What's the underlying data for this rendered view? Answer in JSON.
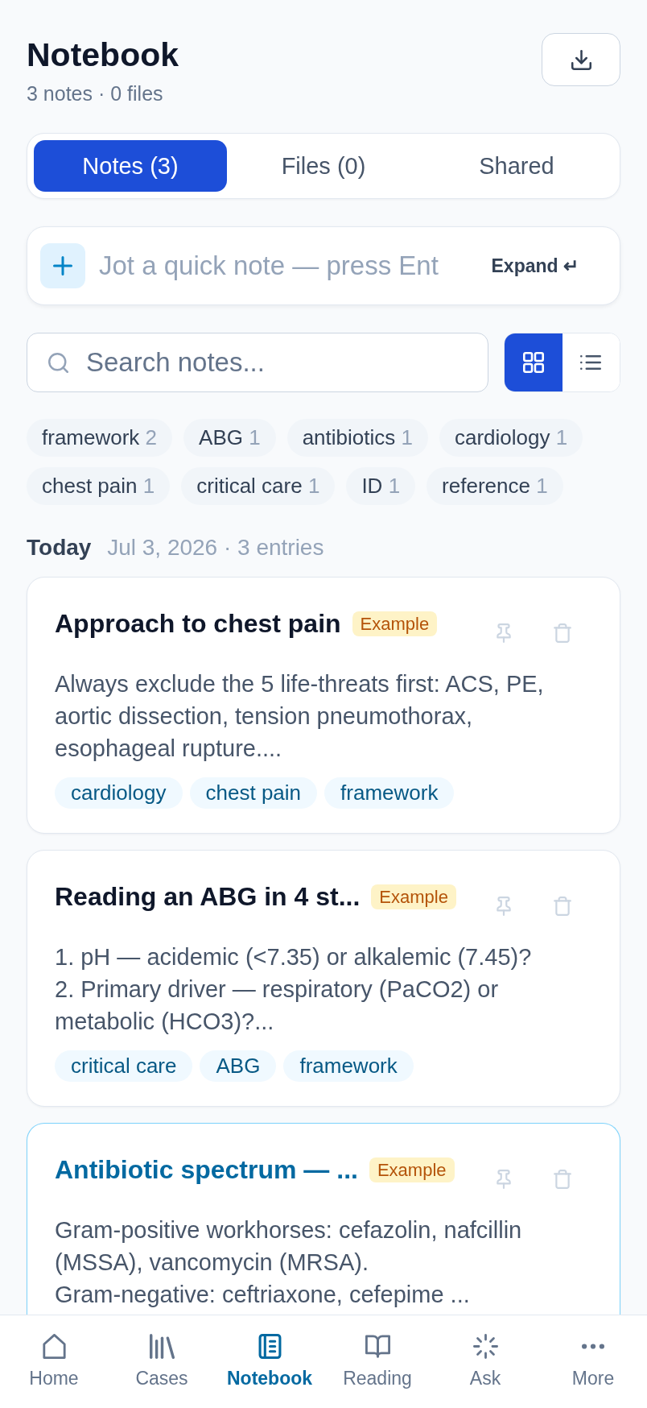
{
  "header": {
    "title": "Notebook",
    "subtitle": "3 notes · 0 files"
  },
  "tabs": [
    {
      "label": "Notes (3)",
      "selected": true
    },
    {
      "label": "Files (0)",
      "selected": false
    },
    {
      "label": "Shared",
      "selected": false
    }
  ],
  "quick_note": {
    "placeholder": "Jot a quick note — press Ent",
    "expand_label": "Expand ↵"
  },
  "search": {
    "placeholder": "Search notes..."
  },
  "view_modes": [
    {
      "kind": "grid",
      "selected": true
    },
    {
      "kind": "list",
      "selected": false
    }
  ],
  "tag_filters": [
    {
      "label": "framework",
      "count": "2",
      "selected": false
    },
    {
      "label": "ABG",
      "count": "1",
      "selected": false
    },
    {
      "label": "antibiotics",
      "count": "1",
      "selected": false
    },
    {
      "label": "cardiology",
      "count": "1",
      "selected": false
    },
    {
      "label": "chest pain",
      "count": "1",
      "selected": false
    },
    {
      "label": "critical care",
      "count": "1",
      "selected": false
    },
    {
      "label": "ID",
      "count": "1",
      "selected": false
    },
    {
      "label": "reference",
      "count": "1",
      "selected": false
    }
  ],
  "section": {
    "label": "Today",
    "meta": "Jul 3, 2026 · 3 entries"
  },
  "notes": [
    {
      "title": "Approach to chest pain",
      "badge": "Example",
      "pinned": false,
      "selected": false,
      "body": "Always exclude the 5 life-threats first: ACS, PE, aortic dissection, tension pneumothorax, esophageal rupture....",
      "tags": [
        "cardiology",
        "chest pain",
        "framework"
      ]
    },
    {
      "title": "Reading an ABG in 4 st...",
      "badge": "Example",
      "pinned": false,
      "selected": false,
      "body": "1. pH — acidemic (<7.35) or alkalemic (7.45)?\n2. Primary driver — respiratory (PaCO2) or metabolic (HCO3)?...",
      "tags": [
        "critical care",
        "ABG",
        "framework"
      ]
    },
    {
      "title": "Antibiotic spectrum — ...",
      "badge": "Example",
      "pinned": false,
      "selected": true,
      "body": "Gram-positive workhorses: cefazolin, nafcillin (MSSA), vancomycin (MRSA).\nGram-negative: ceftriaxone, cefepime ..."
    }
  ],
  "bottom_nav": [
    {
      "kind": "home",
      "label": "Home",
      "selected": false
    },
    {
      "kind": "cases",
      "label": "Cases",
      "selected": false
    },
    {
      "kind": "notebook",
      "label": "Notebook",
      "selected": true
    },
    {
      "kind": "reading",
      "label": "Reading",
      "selected": false
    },
    {
      "kind": "ask",
      "label": "Ask",
      "selected": false
    },
    {
      "kind": "more",
      "label": "More",
      "selected": false
    }
  ]
}
